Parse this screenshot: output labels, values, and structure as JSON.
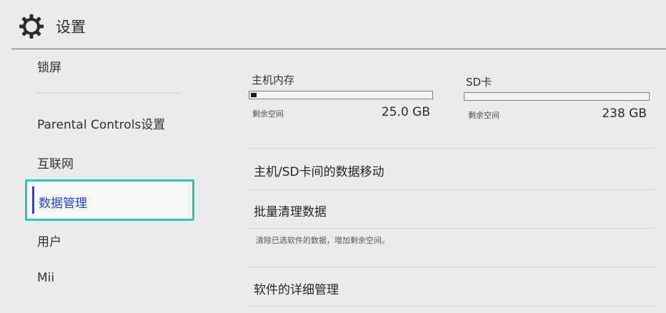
{
  "header": {
    "title": "设置",
    "icon": "gear-icon"
  },
  "sidebar": {
    "items": [
      {
        "label": "锁屏"
      },
      {
        "label": "Parental Controls设置"
      },
      {
        "label": "互联网"
      },
      {
        "label": "数据管理",
        "selected": true
      },
      {
        "label": "用户"
      },
      {
        "label": "Mii"
      }
    ]
  },
  "storage": {
    "system": {
      "label": "主机内存",
      "free_label": "剩余空间",
      "free_value": "25.0 GB",
      "used_fraction": 0.03
    },
    "sd": {
      "label": "SD卡",
      "free_label": "剩余空间",
      "free_value": "238 GB",
      "used_fraction": 0.0
    }
  },
  "menu": {
    "items": [
      {
        "label": "主机/SD卡间的数据移动",
        "description": ""
      },
      {
        "label": "批量清理数据",
        "description": "清除已选软件的数据，增加剩余空间。"
      },
      {
        "label": "软件的详细管理",
        "description": ""
      }
    ]
  },
  "colors": {
    "accent": "#2ac7c1",
    "selected_text": "#2c3fd0",
    "background": "#eaecec"
  }
}
